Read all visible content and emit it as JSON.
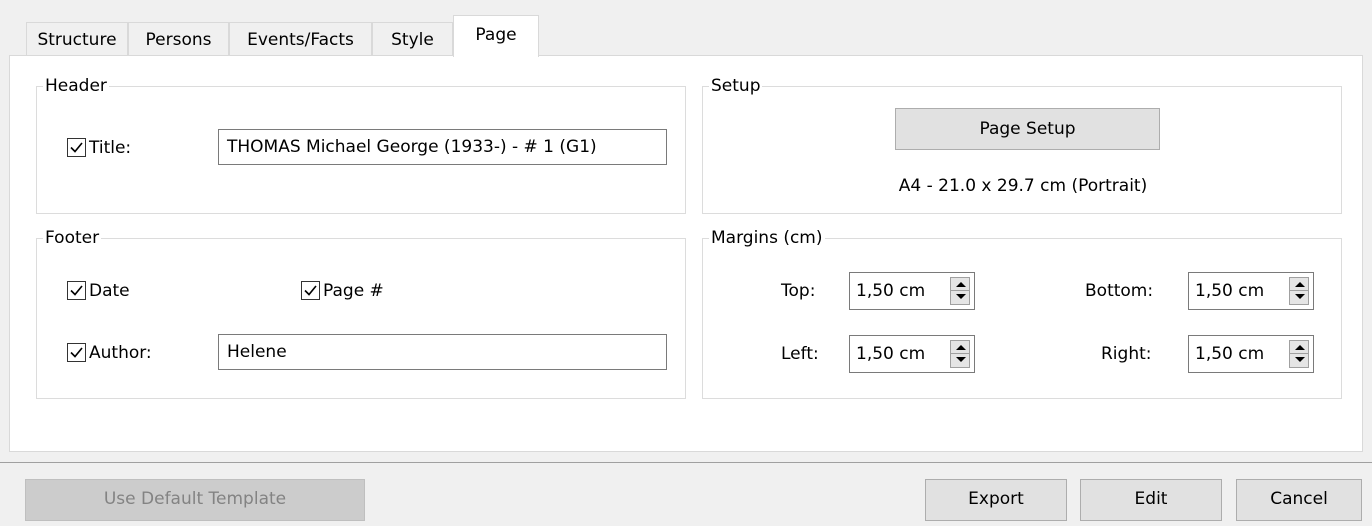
{
  "tabs": [
    {
      "label": "Structure"
    },
    {
      "label": "Persons"
    },
    {
      "label": "Events/Facts"
    },
    {
      "label": "Style"
    },
    {
      "label": "Page"
    }
  ],
  "active_tab": "Page",
  "header": {
    "group_label": "Header",
    "title_checked": true,
    "title_label": "Title:",
    "title_value": "THOMAS Michael George (1933-) - # 1 (G1)"
  },
  "footer": {
    "group_label": "Footer",
    "date_label": "Date",
    "date_checked": true,
    "page_label": "Page #",
    "page_checked": true,
    "author_label": "Author:",
    "author_checked": true,
    "author_value": "Helene"
  },
  "setup": {
    "group_label": "Setup",
    "button_label": "Page Setup",
    "paper_info": "A4 - 21.0 x 29.7 cm (Portrait)"
  },
  "margins": {
    "group_label": "Margins (cm)",
    "top_label": "Top:",
    "top_value": "1,50 cm",
    "bottom_label": "Bottom:",
    "bottom_value": "1,50 cm",
    "left_label": "Left:",
    "left_value": "1,50 cm",
    "right_label": "Right:",
    "right_value": "1,50 cm"
  },
  "buttons": {
    "default_template": "Use Default Template",
    "default_template_enabled": false,
    "export": "Export",
    "edit": "Edit",
    "cancel": "Cancel"
  }
}
